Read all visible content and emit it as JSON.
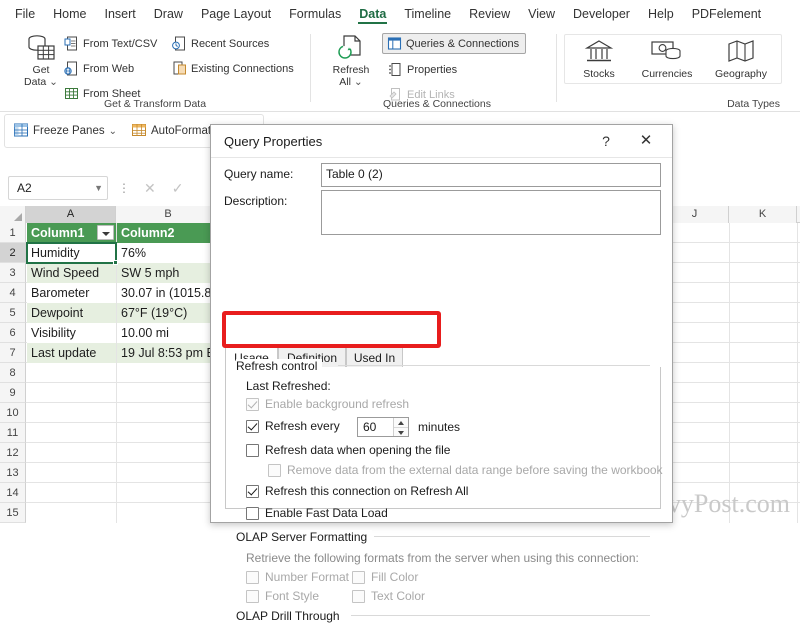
{
  "ribbon": {
    "tabs": [
      {
        "label": "File",
        "active": false
      },
      {
        "label": "Home",
        "active": false
      },
      {
        "label": "Insert",
        "active": false
      },
      {
        "label": "Draw",
        "active": false
      },
      {
        "label": "Page Layout",
        "active": false
      },
      {
        "label": "Formulas",
        "active": false
      },
      {
        "label": "Data",
        "active": true
      },
      {
        "label": "Timeline",
        "active": false
      },
      {
        "label": "Review",
        "active": false
      },
      {
        "label": "View",
        "active": false
      },
      {
        "label": "Developer",
        "active": false
      },
      {
        "label": "Help",
        "active": false
      },
      {
        "label": "PDFelement",
        "active": false
      }
    ],
    "groups": {
      "get_transform": {
        "title": "Get & Transform Data",
        "get_data_label": "Get\nData",
        "get_data_line1": "Get",
        "get_data_line2": "Data",
        "items": [
          {
            "label": "From Text/CSV",
            "icon": "text-csv-icon"
          },
          {
            "label": "From Web",
            "icon": "web-icon"
          },
          {
            "label": "From Sheet",
            "icon": "sheet-icon"
          },
          {
            "label": "Recent Sources",
            "icon": "recent-sources-icon"
          },
          {
            "label": "Existing Connections",
            "icon": "existing-connections-icon"
          }
        ]
      },
      "queries": {
        "title": "Queries & Connections",
        "refresh_all_line1": "Refresh",
        "refresh_all_line2": "All",
        "queries_connections": "Queries & Connections",
        "properties": "Properties",
        "edit_links": "Edit Links"
      },
      "data_types": {
        "title": "Data Types",
        "items": [
          {
            "label": "Stocks",
            "icon": "bank-icon"
          },
          {
            "label": "Currencies",
            "icon": "currency-icon"
          },
          {
            "label": "Geography",
            "icon": "map-icon"
          }
        ]
      }
    },
    "row2": [
      {
        "label": "Freeze Panes",
        "icon": "freeze-panes-icon",
        "caret": true
      },
      {
        "label": "AutoFormat",
        "icon": "autoformat-icon",
        "caret": false
      }
    ]
  },
  "formula_bar": {
    "name_box_value": "A2",
    "cancel_icon": "cancel-icon",
    "confirm_icon": "confirm-icon",
    "fx_icon": "more-icon"
  },
  "sheet": {
    "columns": [
      "A",
      "B",
      "J",
      "K"
    ],
    "selected_column": "A",
    "rows": [
      "1",
      "2",
      "3",
      "4",
      "5",
      "6",
      "7",
      "8",
      "9",
      "10",
      "11",
      "12",
      "13",
      "14",
      "15"
    ],
    "selected_row": "2",
    "cells": [
      {
        "row": 1,
        "a": "Column1",
        "b": "Column2",
        "style": "hdr"
      },
      {
        "row": 2,
        "a": "Humidity",
        "b": "76%",
        "style": "plain"
      },
      {
        "row": 3,
        "a": "Wind Speed",
        "b": "SW 5 mph",
        "style": "band"
      },
      {
        "row": 4,
        "a": "Barometer",
        "b": "30.07 in (1015.8",
        "style": "plain"
      },
      {
        "row": 5,
        "a": "Dewpoint",
        "b": "67°F (19°C)",
        "style": "band"
      },
      {
        "row": 6,
        "a": "Visibility",
        "b": "10.00 mi",
        "style": "plain"
      },
      {
        "row": 7,
        "a": "Last update",
        "b": "19 Jul 8:53 pm E",
        "style": "band"
      }
    ]
  },
  "dialog": {
    "title": "Query Properties",
    "help_icon": "help-icon",
    "close_icon": "close-icon",
    "query_name_label": "Query name:",
    "query_name_value": "Table 0 (2)",
    "description_label": "Description:",
    "description_value": "",
    "tabs": [
      {
        "label": "Usage",
        "active": true
      },
      {
        "label": "Definition",
        "active": false
      },
      {
        "label": "Used In",
        "active": false
      }
    ],
    "refresh_control": {
      "group_title": "Refresh control",
      "last_refreshed_label": "Last Refreshed:",
      "last_refreshed_value": "",
      "enable_background_refresh": {
        "label": "Enable background refresh",
        "checked": true
      },
      "refresh_every": {
        "label": "Refresh every",
        "checked": true,
        "value": "60",
        "unit": "minutes"
      },
      "refresh_on_open": {
        "label": "Refresh data when opening the file",
        "checked": false
      },
      "remove_data": {
        "label": "Remove data from the external data range before saving the workbook",
        "checked": false,
        "disabled": true
      },
      "refresh_on_refresh_all": {
        "label": "Refresh this connection on Refresh All",
        "checked": true
      },
      "enable_fast_data_load": {
        "label": "Enable Fast Data Load",
        "checked": false
      }
    },
    "olap_server_formatting": {
      "group_title": "OLAP Server Formatting",
      "description": "Retrieve the following formats from the server when using this connection:",
      "options": [
        {
          "label": "Number Format",
          "checked": false
        },
        {
          "label": "Fill Color",
          "checked": false
        },
        {
          "label": "Font Style",
          "checked": false
        },
        {
          "label": "Text Color",
          "checked": false
        }
      ]
    },
    "olap_drill_through": {
      "group_title": "OLAP Drill Through"
    }
  },
  "highlight": {
    "color": "#e81d1d",
    "target": "refresh-every-row"
  },
  "watermark": {
    "text": "groovyPost.com"
  },
  "colors": {
    "excel_green": "#217346",
    "table_header_green": "#4a9a54",
    "table_band": "#e6efe0",
    "highlight_red": "#e81d1d"
  }
}
